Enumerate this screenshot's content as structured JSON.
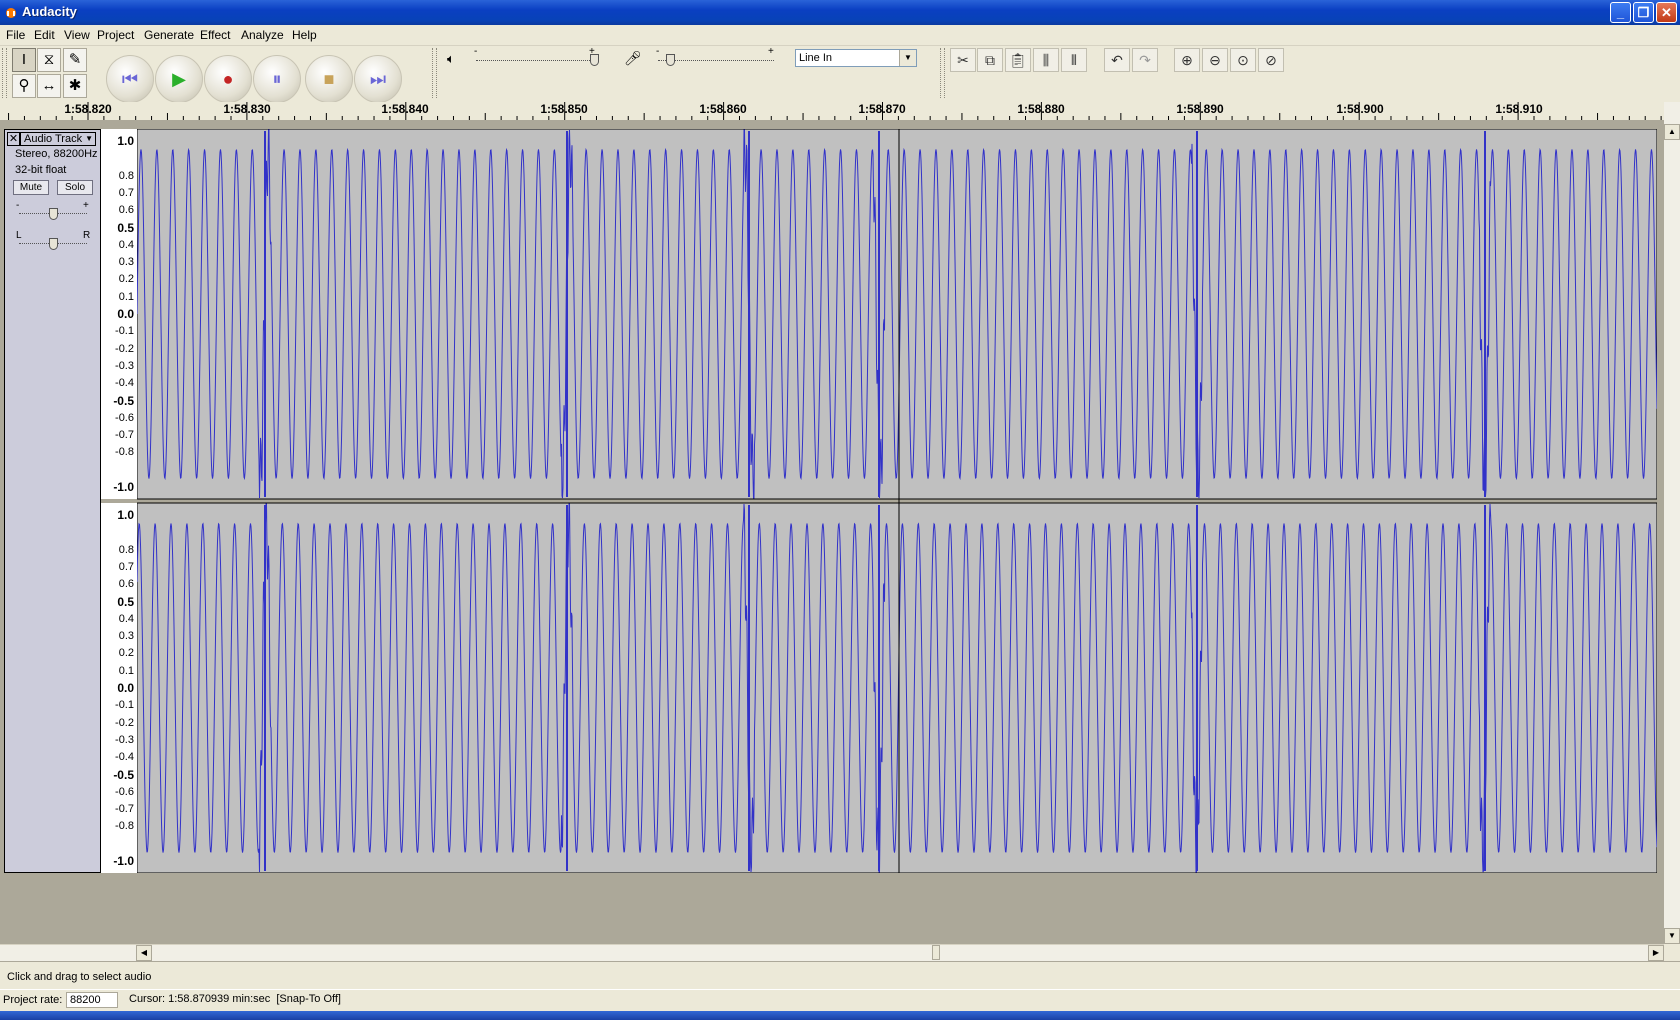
{
  "window": {
    "title": "Audacity",
    "minimize_icon": "minimize-icon",
    "maximize_icon": "restore-icon",
    "close_icon": "close-icon"
  },
  "menu": [
    "File",
    "Edit",
    "View",
    "Project",
    "Generate",
    "Effect",
    "Analyze",
    "Help"
  ],
  "toolbar": {
    "tools": [
      "selection-tool",
      "envelope-tool",
      "draw-tool",
      "zoom-tool",
      "time-shift-tool",
      "multi-tool"
    ],
    "transport": [
      "skip-to-start",
      "play",
      "record",
      "pause",
      "stop",
      "skip-to-end"
    ],
    "playback_slider": {
      "min": "-",
      "max": "+",
      "value": 1.0
    },
    "record_slider": {
      "min": "-",
      "max": "+",
      "value": 0.1
    },
    "input_source": "Line In",
    "edit_tools": [
      "cut-icon",
      "copy-icon",
      "paste-icon",
      "trim-icon",
      "silence-icon",
      "undo-icon",
      "redo-icon",
      "zoom-in-icon",
      "zoom-out-icon",
      "fit-selection-icon",
      "fit-project-icon"
    ]
  },
  "ruler": {
    "labels": [
      "1:58.820",
      "1:58.830",
      "1:58.840",
      "1:58.850",
      "1:58.860",
      "1:58.870",
      "1:58.880",
      "1:58.890",
      "1:58.900",
      "1:58.910"
    ]
  },
  "track": {
    "name": "Audio Track",
    "info_line1": "Stereo, 88200Hz",
    "info_line2": "32-bit float",
    "mute_label": "Mute",
    "solo_label": "Solo",
    "gain_minus": "-",
    "gain_plus": "+",
    "pan_left": "L",
    "pan_right": "R",
    "gain_value": 0.5,
    "pan_value": 0.5
  },
  "amplitude_scale": [
    "1.0",
    "0.8",
    "0.7",
    "0.6",
    "0.5",
    "0.4",
    "0.3",
    "0.2",
    "0.1",
    "0.0",
    "-0.1",
    "-0.2",
    "-0.3",
    "-0.4",
    "-0.5",
    "-0.6",
    "-0.7",
    "-0.8",
    "-1.0"
  ],
  "waveform_color": "#3232c8",
  "status": {
    "hint": "Click and drag to select audio",
    "project_rate_label": "Project rate:",
    "project_rate_value": "88200",
    "cursor_text": "Cursor: 1:58.870939 min:sec",
    "snap_text": "[Snap-To Off]"
  }
}
